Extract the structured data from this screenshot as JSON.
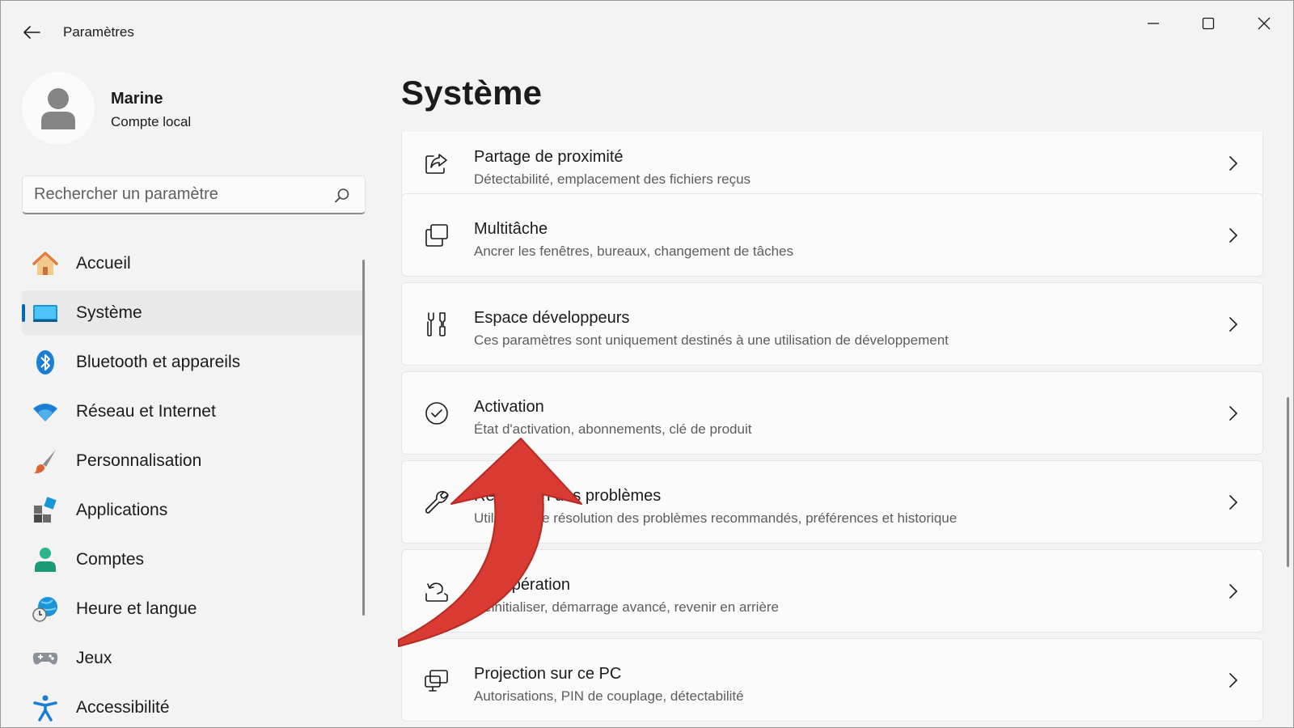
{
  "window": {
    "app_title": "Paramètres"
  },
  "profile": {
    "name": "Marine",
    "account_type": "Compte local"
  },
  "search": {
    "placeholder": "Rechercher un paramètre"
  },
  "sidebar": {
    "items": [
      {
        "label": "Accueil",
        "icon": "home-icon"
      },
      {
        "label": "Système",
        "icon": "system-icon",
        "active": true
      },
      {
        "label": "Bluetooth et appareils",
        "icon": "bluetooth-icon"
      },
      {
        "label": "Réseau et Internet",
        "icon": "wifi-icon"
      },
      {
        "label": "Personnalisation",
        "icon": "brush-icon"
      },
      {
        "label": "Applications",
        "icon": "apps-icon"
      },
      {
        "label": "Comptes",
        "icon": "account-icon"
      },
      {
        "label": "Heure et langue",
        "icon": "globe-clock-icon"
      },
      {
        "label": "Jeux",
        "icon": "gamepad-icon"
      },
      {
        "label": "Accessibilité",
        "icon": "accessibility-icon"
      }
    ]
  },
  "main": {
    "title": "Système",
    "cards": [
      {
        "title": "Partage de proximité",
        "description": "Détectabilité, emplacement des fichiers reçus",
        "icon": "share-icon"
      },
      {
        "title": "Multitâche",
        "description": "Ancrer les fenêtres, bureaux, changement de tâches",
        "icon": "multitask-icon"
      },
      {
        "title": "Espace développeurs",
        "description": "Ces paramètres sont uniquement destinés à une utilisation de développement",
        "icon": "developer-tools-icon"
      },
      {
        "title": "Activation",
        "description": "État d'activation, abonnements, clé de produit",
        "icon": "check-circle-icon"
      },
      {
        "title": "Résolution des problèmes",
        "description": "Utilitaires de résolution des problèmes recommandés, préférences et historique",
        "icon": "wrench-icon"
      },
      {
        "title": "Récupération",
        "description": "Réinitialiser, démarrage avancé, revenir en arrière",
        "icon": "recovery-icon"
      },
      {
        "title": "Projection sur ce PC",
        "description": "Autorisations, PIN de couplage, détectabilité",
        "icon": "projection-icon"
      }
    ]
  },
  "colors": {
    "accent": "#0067c0",
    "annotation_arrow": "#d93a31"
  }
}
